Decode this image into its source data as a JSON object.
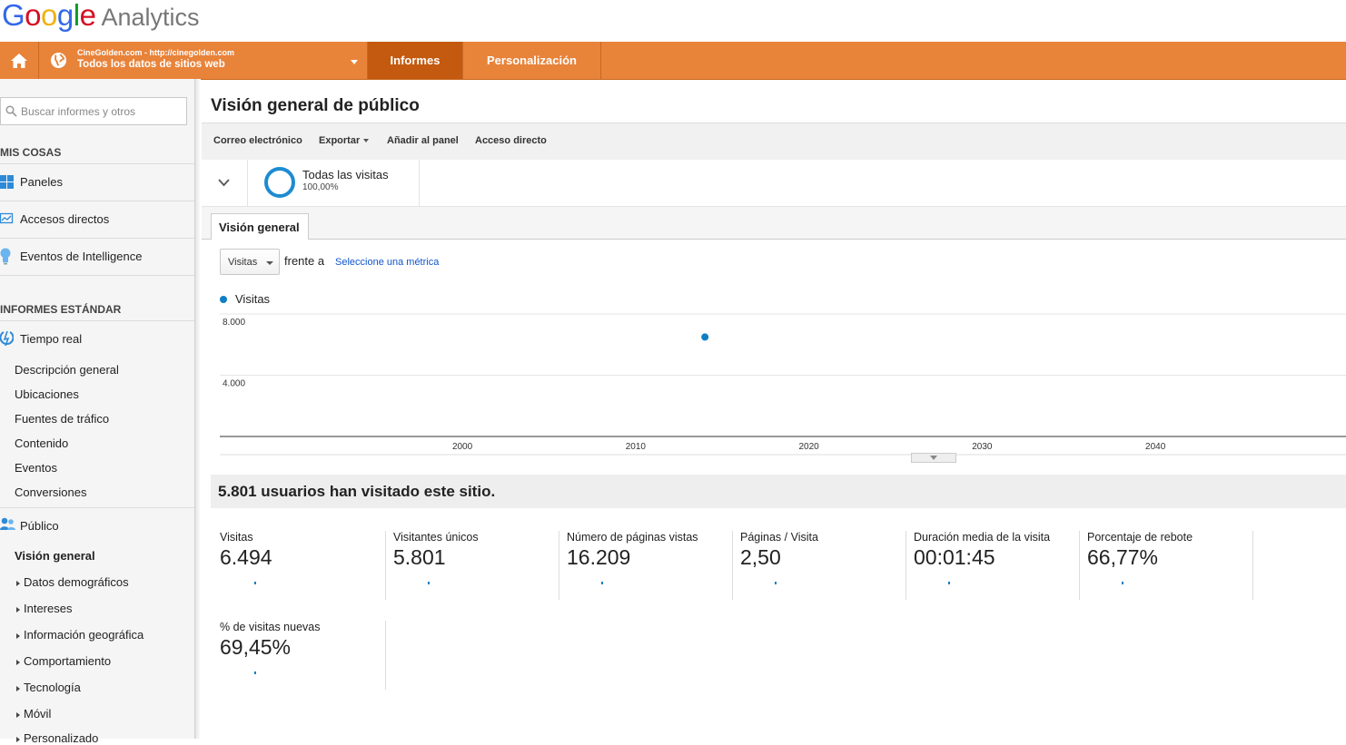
{
  "brand": {
    "google": "Google",
    "product": "Analytics"
  },
  "header": {
    "site_line1": "CineGolden.com - http://cinegolden.com",
    "site_line2": "Todos los datos de sitios web",
    "tabs": [
      {
        "label": "Informes",
        "active": true
      },
      {
        "label": "Personalización",
        "active": false
      }
    ],
    "accent_color": "#e8833a"
  },
  "sidebar": {
    "search_placeholder": "Buscar informes y otros",
    "my_stuff_heading": "MIS COSAS",
    "my_stuff": [
      {
        "label": "Paneles",
        "icon": "dashboard-icon"
      },
      {
        "label": "Accesos directos",
        "icon": "shortcut-icon"
      },
      {
        "label": "Eventos de Intelligence",
        "icon": "lightbulb-icon"
      }
    ],
    "standard_heading": "INFORMES ESTÁNDAR",
    "realtime": {
      "label": "Tiempo real",
      "items": [
        "Descripción general",
        "Ubicaciones",
        "Fuentes de tráfico",
        "Contenido",
        "Eventos",
        "Conversiones"
      ]
    },
    "audience": {
      "label": "Público",
      "selected": "Visión general",
      "items": [
        "Datos demográficos",
        "Intereses",
        "Información geográfica",
        "Comportamiento",
        "Tecnología",
        "Móvil",
        "Personalizado"
      ]
    }
  },
  "main": {
    "title": "Visión general de público",
    "toolbar": {
      "email": "Correo electrónico",
      "export": "Exportar",
      "add_to_dashboard": "Añadir al panel",
      "shortcut": "Acceso directo"
    },
    "segment": {
      "name": "Todas las visitas",
      "percent": "100,00%"
    },
    "tab": "Visión general",
    "metric_select": "Visitas",
    "versus": "frente a",
    "select_metric_link": "Seleccione una métrica",
    "legend": "Visitas",
    "summary": "5.801 usuarios han visitado este sitio.",
    "kpis": [
      {
        "label": "Visitas",
        "value": "6.494"
      },
      {
        "label": "Visitantes únicos",
        "value": "5.801"
      },
      {
        "label": "Número de páginas vistas",
        "value": "16.209"
      },
      {
        "label": "Páginas / Visita",
        "value": "2,50"
      },
      {
        "label": "Duración media de la visita",
        "value": "00:01:45"
      },
      {
        "label": "Porcentaje de rebote",
        "value": "66,77%"
      },
      {
        "label": "% de visitas nuevas",
        "value": "69,45%"
      }
    ]
  },
  "chart_data": {
    "type": "scatter",
    "title": "",
    "series": [
      {
        "name": "Visitas",
        "color": "#0f7fc4",
        "points": [
          {
            "x": 2014,
            "y": 6494
          }
        ]
      }
    ],
    "xlim": [
      1986,
      2051
    ],
    "ylim": [
      0,
      8000
    ],
    "x_ticks": [
      "2000",
      "2010",
      "2020",
      "2030",
      "2040"
    ],
    "x_tick_values": [
      2000,
      2010,
      2020,
      2030,
      2040
    ],
    "y_ticks": [
      "8.000",
      "4.000"
    ],
    "y_tick_values": [
      8000,
      4000
    ],
    "grid": true
  }
}
